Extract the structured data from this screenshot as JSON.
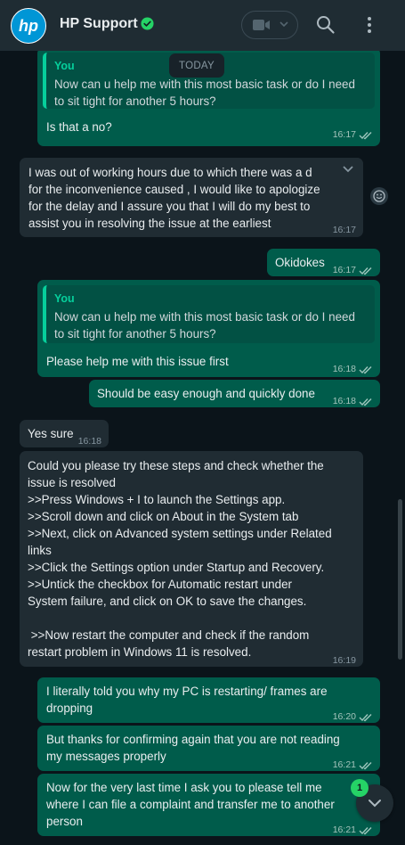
{
  "header": {
    "contact_name": "HP Support",
    "logo_text": "hp"
  },
  "date_separator": "TODAY",
  "messages": [
    {
      "direction": "out",
      "quote": {
        "author": "You",
        "text": "Now can u help me with this most basic task or do I need to sit tight for another 5 hours?"
      },
      "text": "Is that a no?",
      "time": "16:17",
      "status": "read"
    },
    {
      "direction": "in",
      "text": "I was out of working hours due to which there was a d\nfor the inconvenience caused , I would like to apologize\nfor the delay and I assure you that I will do my best to\nassist you in resolving the issue at the earliest",
      "time": "16:17"
    },
    {
      "direction": "out",
      "text": "Okidokes",
      "time": "16:17",
      "status": "read"
    },
    {
      "direction": "out",
      "quote": {
        "author": "You",
        "text": "Now can u help me with this most basic task or do I need to sit tight for another 5 hours?"
      },
      "text": "Please help me with this issue first",
      "time": "16:18",
      "status": "read"
    },
    {
      "direction": "out",
      "text": "Should be easy enough and quickly done",
      "time": "16:18",
      "status": "read"
    },
    {
      "direction": "in",
      "text": "Yes sure",
      "time": "16:18"
    },
    {
      "direction": "in",
      "text": "Could you please try these steps and check whether the\nissue is resolved\n>>Press Windows + I to launch the Settings app.\n>>Scroll down and click on About in the System tab\n>>Next, click on Advanced system settings under Related\nlinks\n>>Click the Settings option under Startup and Recovery.\n>>Untick the checkbox for Automatic restart under\nSystem failure, and click on OK to save the changes.\n\n >>Now restart the computer and check if the random\nrestart problem in Windows 11 is resolved.",
      "time": "16:19"
    },
    {
      "direction": "out",
      "text": "I literally told you why my PC is restarting/ frames are\ndropping",
      "time": "16:20",
      "status": "read"
    },
    {
      "direction": "out",
      "text": "But thanks for confirming again that you are not reading\nmy messages properly",
      "time": "16:21",
      "status": "read"
    },
    {
      "direction": "out",
      "text": "Now for the very last time I ask you to please tell me\nwhere I can file a complaint and transfer me to another\nperson",
      "time": "16:21",
      "status": "read"
    }
  ],
  "unread_count": "1",
  "colors": {
    "header_bg": "#1f2c33",
    "chat_bg": "#0b141a",
    "outgoing_bubble": "#005c4b",
    "incoming_bubble": "#202c33",
    "accent_green": "#06cf9c",
    "read_ticks": "#53bdeb"
  },
  "icons": {
    "avatar": "hp-logo",
    "verified": "verified-badge-icon",
    "video": "video-camera-icon",
    "search": "search-icon",
    "menu": "more-vertical-icon",
    "scroll": "chevron-down-icon"
  }
}
